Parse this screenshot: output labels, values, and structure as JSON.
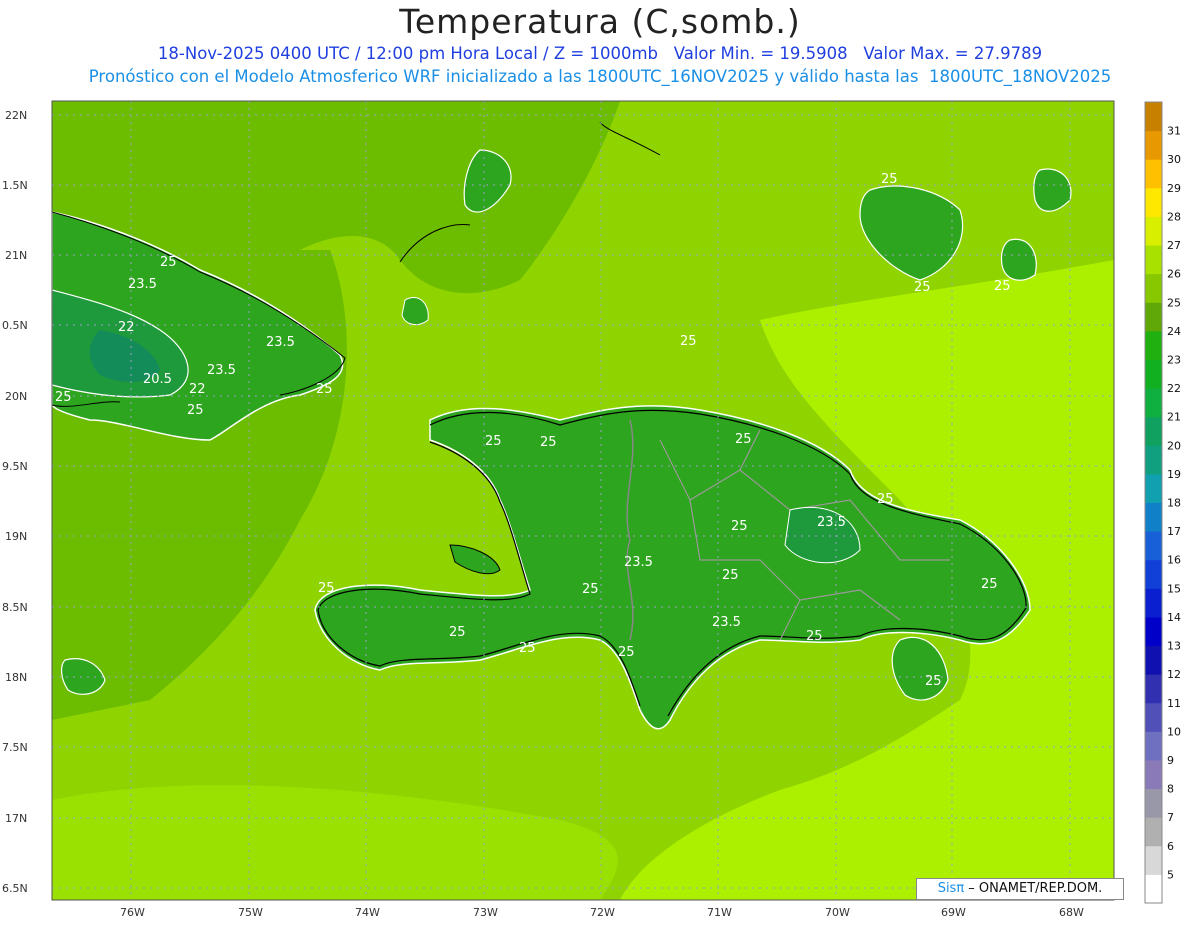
{
  "header": {
    "title": "Temperatura (C,somb.)",
    "line1": "18-Nov-2025 0400 UTC / 12:00 pm Hora Local / Z = 1000mb   Valor Min. = 19.5908   Valor Max. = 27.9789",
    "line2": "Pronóstico con el Modelo Atmosferico WRF inicializado a las 1800UTC_16NOV2025 y válido hasta las  1800UTC_18NOV2025"
  },
  "axes": {
    "lat_labels": [
      "22N",
      "1.5N",
      "21N",
      "0.5N",
      "20N",
      "9.5N",
      "19N",
      "8.5N",
      "18N",
      "7.5N",
      "17N",
      "6.5N"
    ],
    "lon_labels": [
      "76W",
      "75W",
      "74W",
      "73W",
      "72W",
      "71W",
      "70W",
      "69W",
      "68W"
    ]
  },
  "colorbar": {
    "levels": [
      5,
      6,
      7,
      8,
      9,
      10,
      11,
      12,
      13,
      14,
      15,
      16,
      17,
      18,
      19,
      20,
      21,
      22,
      23,
      24,
      25,
      26,
      27,
      28,
      29,
      30,
      31
    ],
    "colors": [
      "#ffffff",
      "#d8d8d8",
      "#b0b0b0",
      "#9898a8",
      "#8a7ab8",
      "#7070c0",
      "#5050b8",
      "#3030b0",
      "#1010b0",
      "#0000c8",
      "#0a20d0",
      "#1040d8",
      "#1860d8",
      "#1080c8",
      "#10a0b0",
      "#10a080",
      "#10a060",
      "#10b040",
      "#10b020",
      "#20b010",
      "#60a808",
      "#88c800",
      "#a8e000",
      "#d8f000",
      "#ffe800",
      "#ffc000",
      "#e89800",
      "#c88000"
    ]
  },
  "contour_labels": [
    "25",
    "23.5",
    "22",
    "20.5",
    "22",
    "23.5",
    "23.5",
    "25",
    "25",
    "25",
    "25",
    "25",
    "25",
    "23.5",
    "25",
    "23.5",
    "25",
    "25",
    "25",
    "23.5",
    "25",
    "25",
    "25",
    "25",
    "25",
    "25",
    "25",
    "25",
    "25",
    "25",
    "25"
  ],
  "credit": {
    "brand": "Sisπ",
    "text": " –  ONAMET/REP.DOM."
  }
}
